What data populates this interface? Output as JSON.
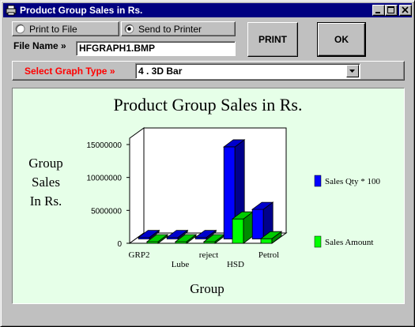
{
  "window": {
    "title": "Product Group Sales in Rs.",
    "minimize_icon": "minimize-icon",
    "maximize_icon": "maximize-icon",
    "close_icon": "close-icon"
  },
  "output": {
    "print_to_file_label": "Print to File",
    "send_to_printer_label": "Send to Printer",
    "selected": "send_to_printer"
  },
  "file_name": {
    "label": "File Name »",
    "value": "HFGRAPH1.BMP"
  },
  "buttons": {
    "print_label": "PRINT",
    "ok_label": "OK"
  },
  "graph_type": {
    "label": "Select Graph Type »",
    "selected": "4 . 3D Bar",
    "label_color": "#ff0000"
  },
  "chart_data": {
    "type": "bar",
    "title": "Product Group Sales in Rs.",
    "ylabel": "Group Sales In Rs.",
    "ylabel_lines": [
      "Group",
      "Sales",
      "In Rs."
    ],
    "xlabel": "Group",
    "categories": [
      "GRP2",
      "Lube",
      "reject",
      "HSD",
      "Petrol"
    ],
    "yticks": [
      "15000000",
      "10000000",
      "5000000",
      "0"
    ],
    "ylim": [
      0,
      15000000
    ],
    "series": [
      {
        "name": "Sales Qty * 100",
        "color": "#0000ff",
        "values": [
          0,
          0,
          0,
          14000000,
          4500000
        ]
      },
      {
        "name": "Sales Amount",
        "color": "#00ff00",
        "values": [
          0,
          0,
          0,
          3700000,
          700000
        ]
      }
    ],
    "legend_position": "right",
    "grid": false,
    "style": "3d"
  }
}
